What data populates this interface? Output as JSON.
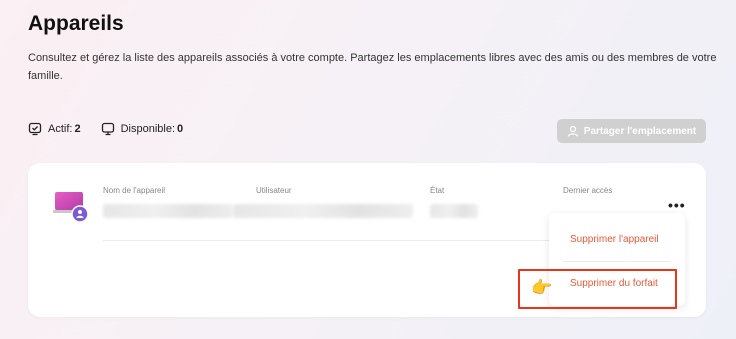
{
  "page": {
    "title": "Appareils",
    "description": "Consultez et gérez la liste des appareils associés à votre compte. Partagez les emplacements libres avec des amis ou des membres de votre famille."
  },
  "stats": {
    "active_label": "Actif:",
    "active_count": "2",
    "available_label": "Disponible:",
    "available_count": "0"
  },
  "share_button": {
    "label": "Partager l'emplacement",
    "enabled": false
  },
  "device_table": {
    "headers": [
      "Nom de l'appareil",
      "Utilisateur",
      "État",
      "Dernier accès"
    ]
  },
  "context_menu": {
    "items": [
      {
        "label": "Supprimer l'appareil"
      },
      {
        "label": "Supprimer du forfait",
        "highlighted": true
      }
    ]
  },
  "colors": {
    "accent": "#e85a38",
    "highlight_border": "#e8361c",
    "disabled_button": "#d0d0d0",
    "device_badge": "#7b5cd6"
  },
  "icons": {
    "active": "device-check-icon",
    "available": "monitor-icon",
    "share": "user-icon",
    "device": "laptop-icon",
    "badge": "user-badge-icon",
    "more": "more-horizontal-icon",
    "pointer": "pointing-hand-icon"
  }
}
